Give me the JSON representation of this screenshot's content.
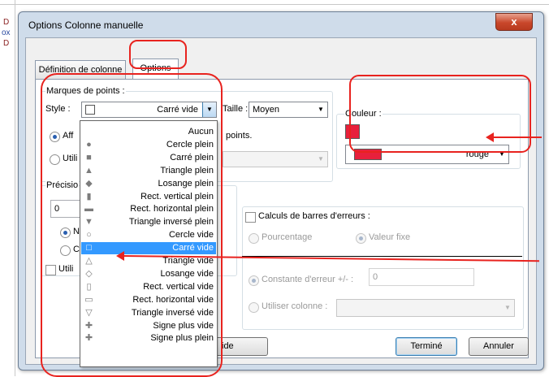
{
  "background": {
    "fragments": [
      "D",
      "ox",
      "D"
    ]
  },
  "window": {
    "title": "Options Colonne manuelle",
    "close_label": "x"
  },
  "tabs": [
    {
      "label": "Définition de colonne"
    },
    {
      "label": "Options"
    }
  ],
  "point_marks": {
    "group_label": "Marques de points :",
    "style_label": "Style :",
    "style_value": "Carré vide",
    "size_label": "Taille :",
    "size_value": "Moyen",
    "display_prefix": "Aff",
    "points_suffix": "points.",
    "use_prefix": "Utili"
  },
  "precision": {
    "label": "Précisio",
    "value": "0",
    "radio1_prefix": "No",
    "radio2_prefix": "Cl",
    "check_prefix": "Utili"
  },
  "color": {
    "group_label": "Couleur :",
    "value": "rouge",
    "swatch_color": "#e8203c"
  },
  "error_bars": {
    "check_label": "Calculs de barres d'erreurs :",
    "radio_percent": "Pourcentage",
    "radio_fixed": "Valeur fixe",
    "constant_label": "Constante d'erreur +/- :",
    "constant_value": "0",
    "use_column_label": "Utiliser colonne :"
  },
  "style_options": [
    {
      "label": "Aucun",
      "icon": "none"
    },
    {
      "label": "Cercle plein",
      "icon": "●"
    },
    {
      "label": "Carré plein",
      "icon": "■"
    },
    {
      "label": "Triangle plein",
      "icon": "▲"
    },
    {
      "label": "Losange plein",
      "icon": "◆"
    },
    {
      "label": "Rect. vertical plein",
      "icon": "▮"
    },
    {
      "label": "Rect. horizontal plein",
      "icon": "▬"
    },
    {
      "label": "Triangle inversé plein",
      "icon": "▼"
    },
    {
      "label": "Cercle vide",
      "icon": "○"
    },
    {
      "label": "Carré vide",
      "icon": "□",
      "selected": true
    },
    {
      "label": "Triangle vide",
      "icon": "△"
    },
    {
      "label": "Losange vide",
      "icon": "◇"
    },
    {
      "label": "Rect. vertical vide",
      "icon": "▯"
    },
    {
      "label": "Rect. horizontal vide",
      "icon": "▭"
    },
    {
      "label": "Triangle inversé vide",
      "icon": "▽"
    },
    {
      "label": "Signe plus vide",
      "icon": "✚"
    },
    {
      "label": "Signe plus plein",
      "icon": "✚"
    }
  ],
  "buttons": {
    "help_suffix": "ide",
    "done": "Terminé",
    "cancel": "Annuler"
  },
  "annotation_color": "#e8231f"
}
